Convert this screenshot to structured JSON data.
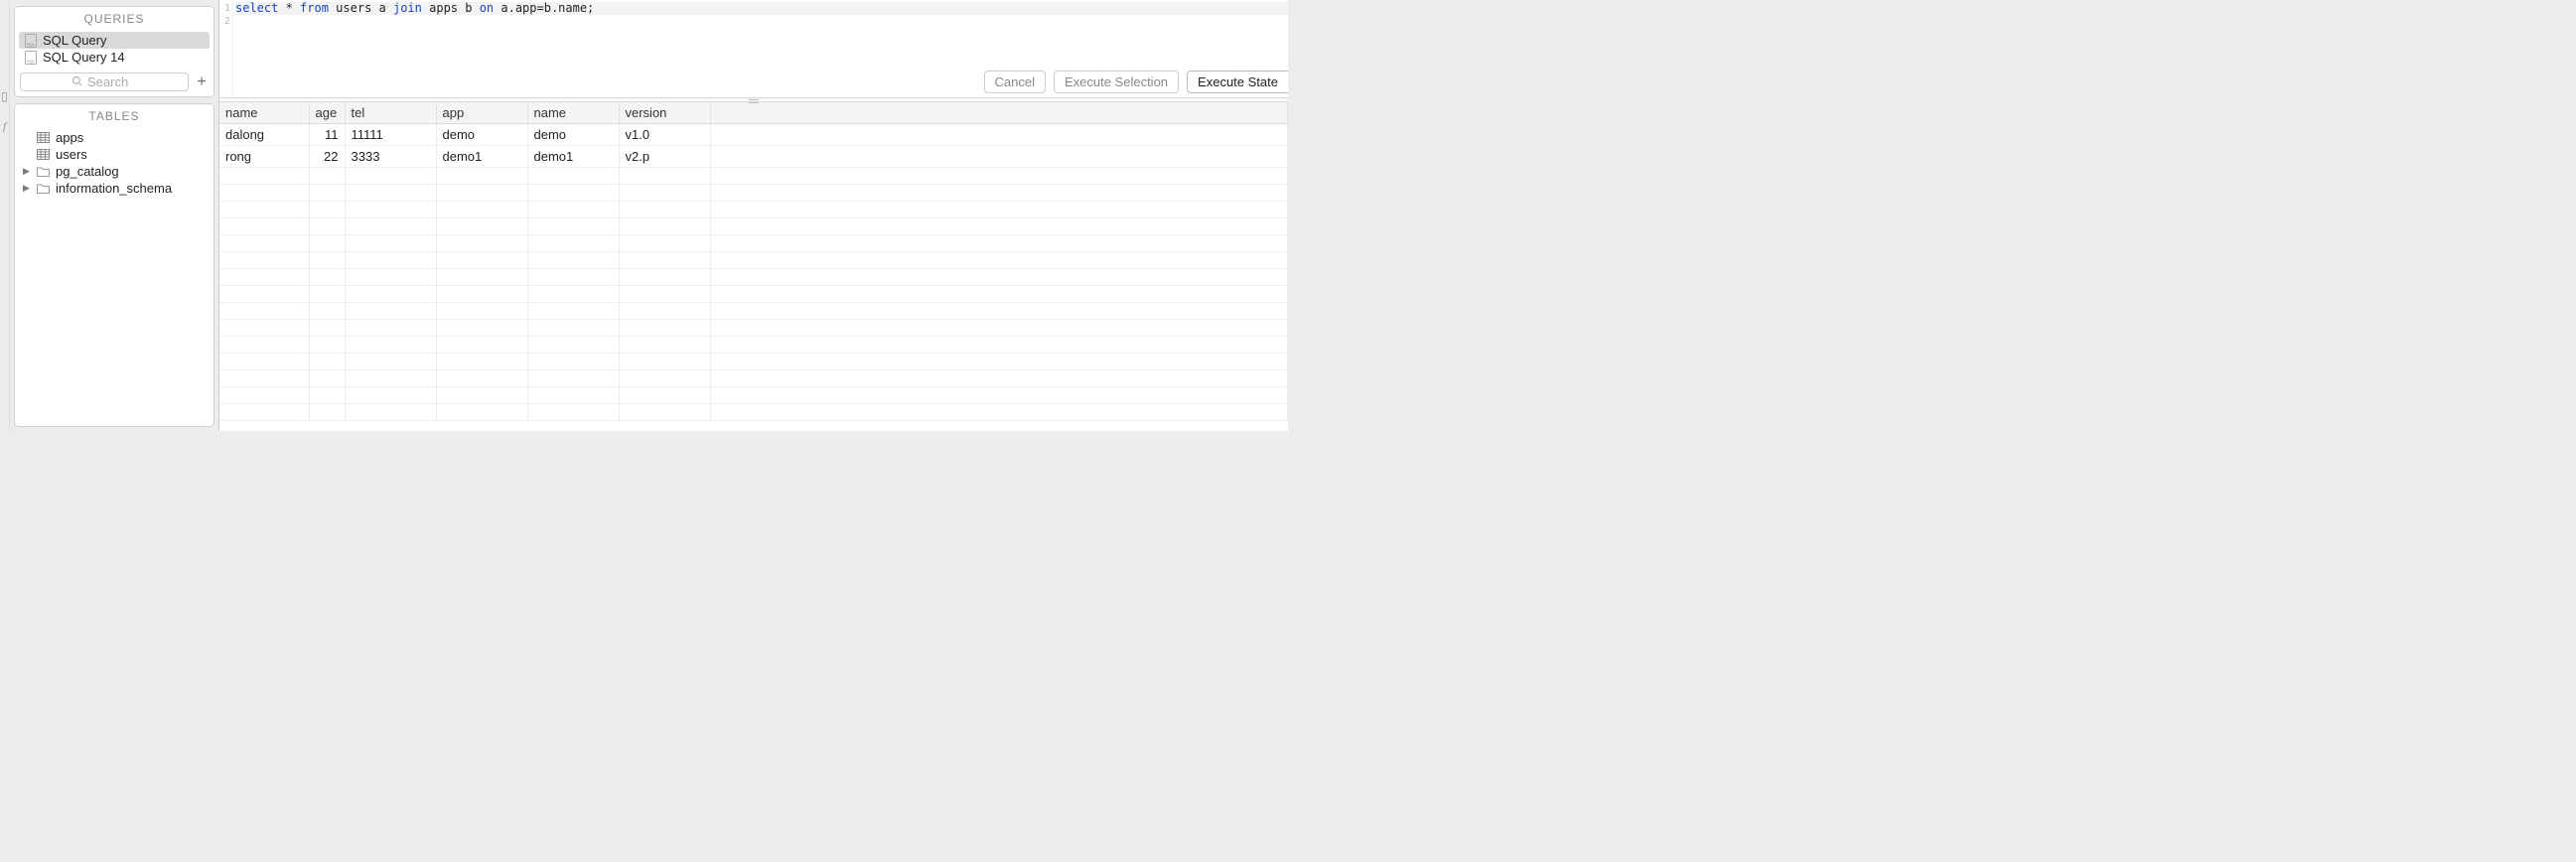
{
  "sidebar": {
    "queries_header": "QUERIES",
    "queries": [
      {
        "label": "SQL Query",
        "active": true
      },
      {
        "label": "SQL Query 14",
        "active": false
      }
    ],
    "search_placeholder": "Search",
    "tables_header": "TABLES",
    "tables": [
      {
        "label": "apps",
        "kind": "table"
      },
      {
        "label": "users",
        "kind": "table"
      },
      {
        "label": "pg_catalog",
        "kind": "schema"
      },
      {
        "label": "information_schema",
        "kind": "schema"
      }
    ]
  },
  "editor": {
    "lines": [
      "1",
      "2"
    ],
    "sql_tokens": [
      {
        "t": "select",
        "c": "kw"
      },
      {
        "t": " * ",
        "c": "pl"
      },
      {
        "t": "from",
        "c": "kw"
      },
      {
        "t": " users a ",
        "c": "pl"
      },
      {
        "t": "join",
        "c": "kw"
      },
      {
        "t": " apps b ",
        "c": "pl"
      },
      {
        "t": "on",
        "c": "kw"
      },
      {
        "t": " a.app=b.name;",
        "c": "pl"
      }
    ],
    "buttons": {
      "cancel": "Cancel",
      "exec_selection": "Execute Selection",
      "exec_statement": "Execute State"
    }
  },
  "results": {
    "columns": [
      "name",
      "age",
      "tel",
      "app",
      "name",
      "version"
    ],
    "rows": [
      {
        "name": "dalong",
        "age": 11,
        "tel": "11111",
        "app": "demo",
        "name2": "demo",
        "version": "v1.0"
      },
      {
        "name": "rong",
        "age": 22,
        "tel": "3333",
        "app": "demo1",
        "name2": "demo1",
        "version": "v2.p"
      }
    ]
  }
}
